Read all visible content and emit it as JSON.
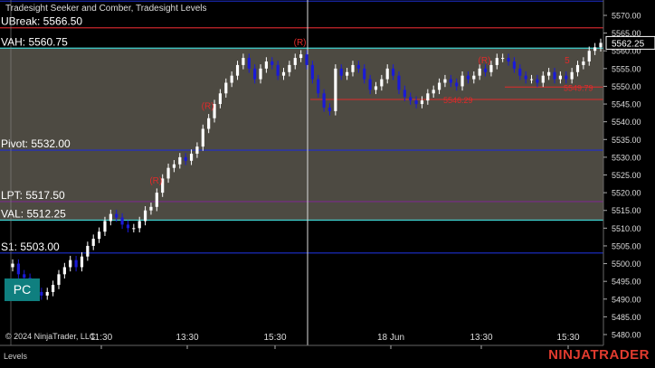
{
  "header": {
    "indicators": "Tradesight Seeker and Comber, Tradesight Levels"
  },
  "buttons": {
    "pc": "PC"
  },
  "copyright": "© 2024 NinjaTrader, LLC",
  "footer": {
    "panel_label": "Levels",
    "logo": "NINJATRADER"
  },
  "colors": {
    "background": "#000000",
    "range_fill": "#4d4a42",
    "up_bar": "#ffffff",
    "down_bar": "#1a1ad6",
    "level_red": "#c8262c",
    "level_cyan": "#3fd1cf",
    "level_blue": "#1e2fd0",
    "level_purple": "#7a2a8a",
    "signal_green": "#2db82d",
    "signal_red": "#e02a2a",
    "price_box": "#ffffff"
  },
  "chart_data": {
    "type": "candlestick",
    "title": "",
    "ylim": [
      5476,
      5574
    ],
    "y_ticks": [
      5570,
      5565,
      5560,
      5555,
      5550,
      5545,
      5540,
      5535,
      5530,
      5525,
      5520,
      5515,
      5510,
      5505,
      5500,
      5495,
      5490,
      5485,
      5480
    ],
    "y_tick_labels": [
      "5570.00",
      "5565.00",
      "5560.00",
      "5555.00",
      "5550.00",
      "5545.00",
      "5540.00",
      "5535.00",
      "5530.00",
      "5525.00",
      "5520.00",
      "5515.00",
      "5510.00",
      "5505.00",
      "5500.00",
      "5495.00",
      "5490.00",
      "5485.00",
      "5480.00"
    ],
    "x_ticks": [
      "11:30",
      "13:30",
      "15:30",
      "18 Jun",
      "13:30",
      "15:30"
    ],
    "session_break_after_tick": "15:30",
    "current_price": "5562.25",
    "levels": [
      {
        "label": "UBreak: 5566.50",
        "value": 5566.5,
        "color": "red"
      },
      {
        "label": "VAH: 5560.75",
        "value": 5560.75,
        "color": "cyan"
      },
      {
        "label": "Pivot: 5532.00",
        "value": 5532.0,
        "color": "blue"
      },
      {
        "label": "LPT: 5517.50",
        "value": 5517.5,
        "color": "purple"
      },
      {
        "label": "VAL: 5512.25",
        "value": 5512.25,
        "color": "cyan"
      },
      {
        "label": "S1: 5503.00",
        "value": 5503.0,
        "color": "blue"
      }
    ],
    "upper_blue_level": 5574,
    "value_area": [
      5512.25,
      5560.75
    ],
    "short_levels": [
      {
        "label": "5546.29",
        "value": 5546.29
      },
      {
        "label": "5549.79",
        "value": 5549.79
      }
    ],
    "closes": [
      5500,
      5497,
      5496,
      5494,
      5492,
      5491,
      5492,
      5494,
      5497,
      5499,
      5501,
      5499,
      5502,
      5505,
      5507,
      5509,
      5512,
      5514,
      5513,
      5511,
      5510,
      5510,
      5512,
      5515,
      5516,
      5520,
      5524,
      5527,
      5528,
      5530,
      5529,
      5531,
      5533,
      5538,
      5541,
      5545,
      5548,
      5551,
      5553,
      5556,
      5558,
      5555,
      5552,
      5555,
      5557,
      5556,
      5553,
      5554,
      5556,
      5558,
      5559,
      5556,
      5552,
      5548,
      5544,
      5543,
      5555,
      5553,
      5554,
      5556,
      5555,
      5552,
      5549,
      5550,
      5552,
      5555,
      5553,
      5549,
      5547,
      5546,
      5545,
      5546,
      5548,
      5549,
      5551,
      5552,
      5551,
      5550,
      5553,
      5552,
      5553,
      5555,
      5554,
      5556,
      5558,
      5558,
      5557,
      5555,
      5553,
      5552,
      5552,
      5551,
      5553,
      5554,
      5552,
      5553,
      5552,
      5554,
      5556,
      5557,
      5560,
      5561,
      5562.25
    ],
    "signals": [
      {
        "label": "(R)",
        "type": "resistance",
        "bar": 34
      },
      {
        "label": "(R)",
        "type": "resistance",
        "bar": 25
      },
      {
        "label": "(R)",
        "type": "resistance",
        "bar": 50
      },
      {
        "label": "(R)",
        "type": "resistance",
        "bar": 82
      },
      {
        "label": "5",
        "type": "count",
        "bar": 97
      }
    ]
  }
}
